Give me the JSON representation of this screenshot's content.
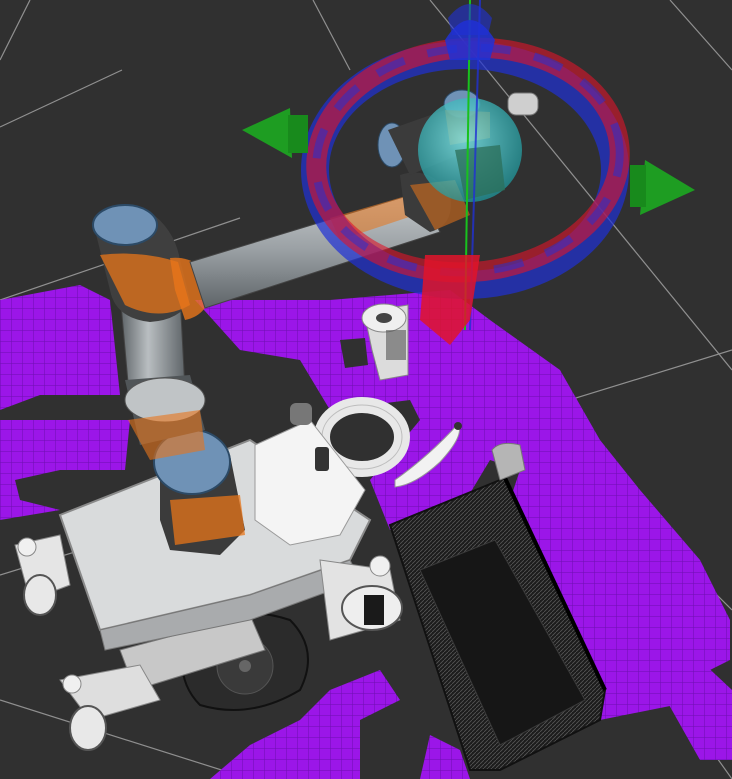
{
  "viewer": {
    "background": "#303030",
    "grid_color": "#a8a8a8",
    "occupancy_color": "#9b16e8"
  },
  "scene": {
    "robot": {
      "name": "mobile-manipulator",
      "arm_color": "#8f9497",
      "joint_cap_color": "#6f92b6",
      "texture_color": "#e8751a",
      "base_color": "#d9dbdc"
    },
    "interactive_marker": {
      "ring_red": "#e0142a",
      "ring_blue": "#2031d6",
      "arrow_green": "#1e9d22",
      "sphere_cyan": "#43d1d3"
    },
    "objects": [
      {
        "name": "can"
      },
      {
        "name": "ring"
      },
      {
        "name": "banana"
      },
      {
        "name": "bottle"
      },
      {
        "name": "box"
      }
    ]
  }
}
